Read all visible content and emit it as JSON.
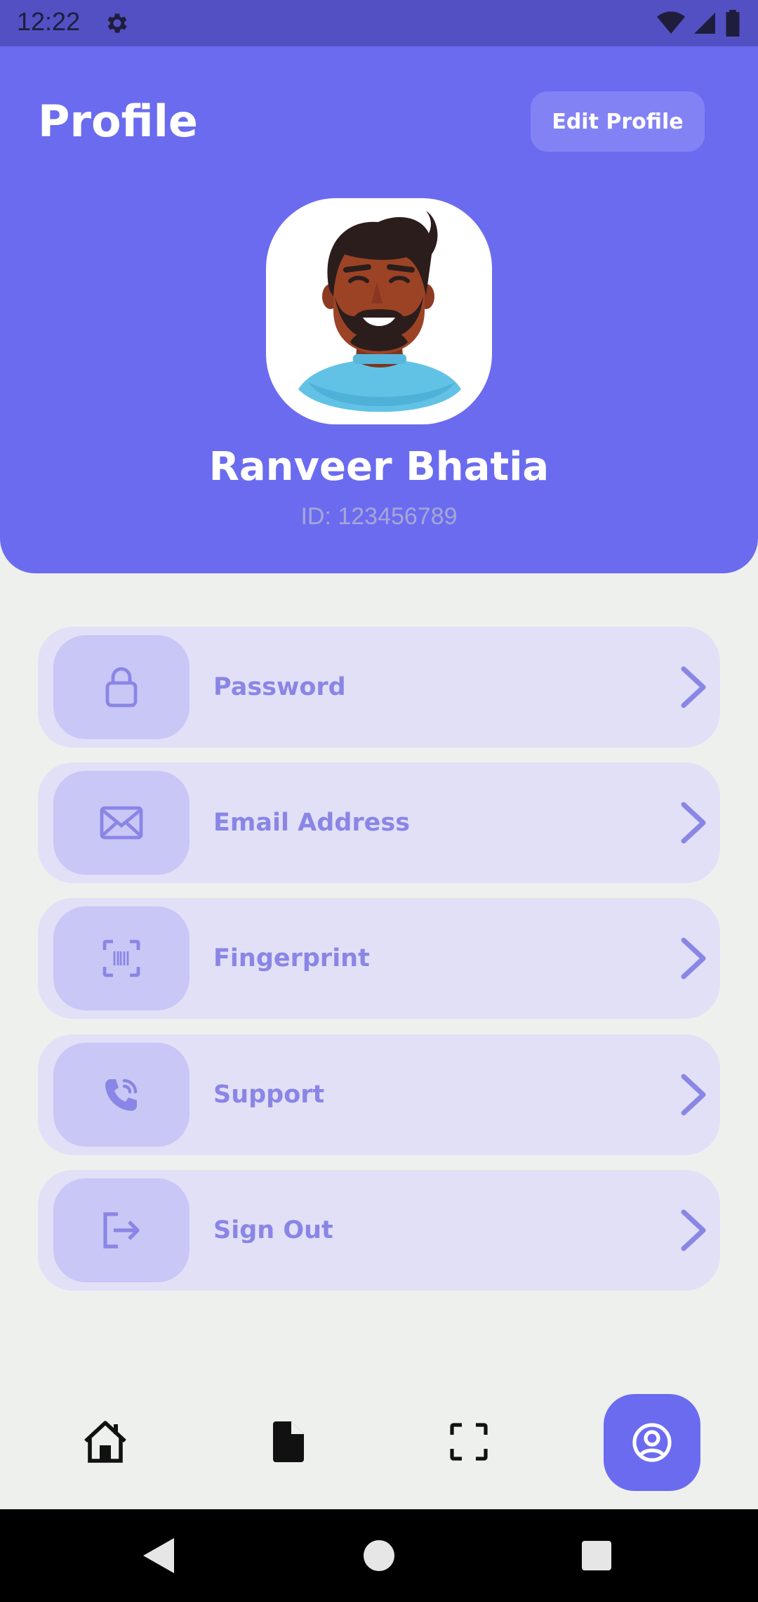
{
  "status_bar": {
    "time": "12:22",
    "icons": [
      "gear-icon",
      "wifi-icon",
      "signal-icon",
      "battery-icon"
    ]
  },
  "header": {
    "title": "Profile",
    "edit_button_label": "Edit Profile",
    "user_name": "Ranveer Bhatia",
    "user_id": "ID: 123456789",
    "background_color": "#6b6bf0"
  },
  "menu": {
    "items": [
      {
        "label": "Password",
        "icon": "lock-icon"
      },
      {
        "label": "Email Address",
        "icon": "mail-icon"
      },
      {
        "label": "Fingerprint",
        "icon": "fingerprint-scan-icon"
      },
      {
        "label": "Support",
        "icon": "phone-icon"
      },
      {
        "label": "Sign Out",
        "icon": "sign-out-icon"
      }
    ],
    "item_background": "#e2e0f7",
    "icon_background": "#c9c7f6",
    "label_color": "#8a86e6"
  },
  "bottom_nav": {
    "items": [
      "home-icon",
      "document-icon",
      "scan-icon",
      "profile-icon"
    ],
    "active": "profile-icon"
  },
  "system_nav": [
    "back-icon",
    "home-circle-icon",
    "recents-icon"
  ]
}
